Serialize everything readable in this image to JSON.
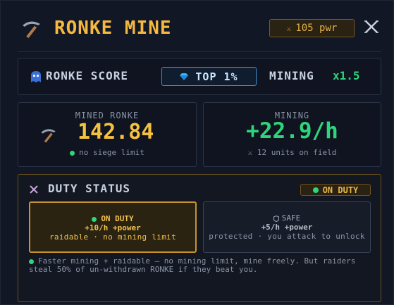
{
  "header": {
    "title": "RONKE MINE",
    "power": "105 pwr",
    "power_icon": "swords-icon",
    "close_icon": "close-icon"
  },
  "score_bar": {
    "label": "RONKE SCORE",
    "rank_badge": "TOP 1%",
    "mining_label": "MINING",
    "mining_multiplier": "x1.5"
  },
  "stats": {
    "mined": {
      "caption": "MINED RONKE",
      "value": "142.84",
      "note": "no siege limit"
    },
    "mining": {
      "caption": "MINING",
      "value": "+22.9/h",
      "note": "12 units on field"
    }
  },
  "duty": {
    "title": "DUTY STATUS",
    "badge": "ON DUTY",
    "options": [
      {
        "name": "ON DUTY",
        "rate": "+10/h +power",
        "desc": "raidable · no mining limit",
        "selected": true
      },
      {
        "name": "SAFE",
        "rate": "+5/h +power",
        "desc": "protected · you attack to unlock",
        "selected": false
      }
    ],
    "description": "Faster mining + raidable — no mining limit, mine freely. But raiders steal 50% of un-withdrawn RONKE if they beat you."
  },
  "colors": {
    "accent_gold": "#f5b940",
    "accent_green": "#2fd57a",
    "accent_blue": "#3d8fd0",
    "background": "#111724"
  }
}
